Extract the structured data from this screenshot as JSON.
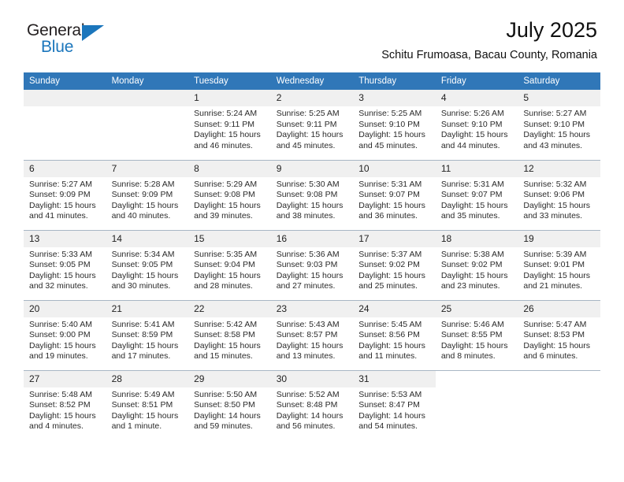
{
  "logo": {
    "word_one": "General",
    "word_two": "Blue",
    "triangle_color": "#1b76bc"
  },
  "header": {
    "title": "July 2025",
    "subtitle": "Schitu Frumoasa, Bacau County, Romania"
  },
  "theme": {
    "header_blue": "#3077b8",
    "day_band_gray": "#f0f0f0",
    "row_divider": "#a8b6c4"
  },
  "weekday_headers": [
    "Sunday",
    "Monday",
    "Tuesday",
    "Wednesday",
    "Thursday",
    "Friday",
    "Saturday"
  ],
  "labels": {
    "sunrise": "Sunrise:",
    "sunset": "Sunset:",
    "daylight": "Daylight:"
  },
  "weeks": [
    [
      {
        "day": "",
        "sunrise": "",
        "sunset": "",
        "daylight_line1": "",
        "daylight_line2": "",
        "banded": true
      },
      {
        "day": "",
        "sunrise": "",
        "sunset": "",
        "daylight_line1": "",
        "daylight_line2": "",
        "banded": true
      },
      {
        "day": "1",
        "sunrise": "Sunrise: 5:24 AM",
        "sunset": "Sunset: 9:11 PM",
        "daylight_line1": "Daylight: 15 hours",
        "daylight_line2": "and 46 minutes.",
        "banded": true
      },
      {
        "day": "2",
        "sunrise": "Sunrise: 5:25 AM",
        "sunset": "Sunset: 9:11 PM",
        "daylight_line1": "Daylight: 15 hours",
        "daylight_line2": "and 45 minutes.",
        "banded": true
      },
      {
        "day": "3",
        "sunrise": "Sunrise: 5:25 AM",
        "sunset": "Sunset: 9:10 PM",
        "daylight_line1": "Daylight: 15 hours",
        "daylight_line2": "and 45 minutes.",
        "banded": true
      },
      {
        "day": "4",
        "sunrise": "Sunrise: 5:26 AM",
        "sunset": "Sunset: 9:10 PM",
        "daylight_line1": "Daylight: 15 hours",
        "daylight_line2": "and 44 minutes.",
        "banded": true
      },
      {
        "day": "5",
        "sunrise": "Sunrise: 5:27 AM",
        "sunset": "Sunset: 9:10 PM",
        "daylight_line1": "Daylight: 15 hours",
        "daylight_line2": "and 43 minutes.",
        "banded": true
      }
    ],
    [
      {
        "day": "6",
        "sunrise": "Sunrise: 5:27 AM",
        "sunset": "Sunset: 9:09 PM",
        "daylight_line1": "Daylight: 15 hours",
        "daylight_line2": "and 41 minutes.",
        "banded": true
      },
      {
        "day": "7",
        "sunrise": "Sunrise: 5:28 AM",
        "sunset": "Sunset: 9:09 PM",
        "daylight_line1": "Daylight: 15 hours",
        "daylight_line2": "and 40 minutes.",
        "banded": true
      },
      {
        "day": "8",
        "sunrise": "Sunrise: 5:29 AM",
        "sunset": "Sunset: 9:08 PM",
        "daylight_line1": "Daylight: 15 hours",
        "daylight_line2": "and 39 minutes.",
        "banded": true
      },
      {
        "day": "9",
        "sunrise": "Sunrise: 5:30 AM",
        "sunset": "Sunset: 9:08 PM",
        "daylight_line1": "Daylight: 15 hours",
        "daylight_line2": "and 38 minutes.",
        "banded": true
      },
      {
        "day": "10",
        "sunrise": "Sunrise: 5:31 AM",
        "sunset": "Sunset: 9:07 PM",
        "daylight_line1": "Daylight: 15 hours",
        "daylight_line2": "and 36 minutes.",
        "banded": true
      },
      {
        "day": "11",
        "sunrise": "Sunrise: 5:31 AM",
        "sunset": "Sunset: 9:07 PM",
        "daylight_line1": "Daylight: 15 hours",
        "daylight_line2": "and 35 minutes.",
        "banded": true
      },
      {
        "day": "12",
        "sunrise": "Sunrise: 5:32 AM",
        "sunset": "Sunset: 9:06 PM",
        "daylight_line1": "Daylight: 15 hours",
        "daylight_line2": "and 33 minutes.",
        "banded": true
      }
    ],
    [
      {
        "day": "13",
        "sunrise": "Sunrise: 5:33 AM",
        "sunset": "Sunset: 9:05 PM",
        "daylight_line1": "Daylight: 15 hours",
        "daylight_line2": "and 32 minutes.",
        "banded": true
      },
      {
        "day": "14",
        "sunrise": "Sunrise: 5:34 AM",
        "sunset": "Sunset: 9:05 PM",
        "daylight_line1": "Daylight: 15 hours",
        "daylight_line2": "and 30 minutes.",
        "banded": true
      },
      {
        "day": "15",
        "sunrise": "Sunrise: 5:35 AM",
        "sunset": "Sunset: 9:04 PM",
        "daylight_line1": "Daylight: 15 hours",
        "daylight_line2": "and 28 minutes.",
        "banded": true
      },
      {
        "day": "16",
        "sunrise": "Sunrise: 5:36 AM",
        "sunset": "Sunset: 9:03 PM",
        "daylight_line1": "Daylight: 15 hours",
        "daylight_line2": "and 27 minutes.",
        "banded": true
      },
      {
        "day": "17",
        "sunrise": "Sunrise: 5:37 AM",
        "sunset": "Sunset: 9:02 PM",
        "daylight_line1": "Daylight: 15 hours",
        "daylight_line2": "and 25 minutes.",
        "banded": true
      },
      {
        "day": "18",
        "sunrise": "Sunrise: 5:38 AM",
        "sunset": "Sunset: 9:02 PM",
        "daylight_line1": "Daylight: 15 hours",
        "daylight_line2": "and 23 minutes.",
        "banded": true
      },
      {
        "day": "19",
        "sunrise": "Sunrise: 5:39 AM",
        "sunset": "Sunset: 9:01 PM",
        "daylight_line1": "Daylight: 15 hours",
        "daylight_line2": "and 21 minutes.",
        "banded": true
      }
    ],
    [
      {
        "day": "20",
        "sunrise": "Sunrise: 5:40 AM",
        "sunset": "Sunset: 9:00 PM",
        "daylight_line1": "Daylight: 15 hours",
        "daylight_line2": "and 19 minutes.",
        "banded": true
      },
      {
        "day": "21",
        "sunrise": "Sunrise: 5:41 AM",
        "sunset": "Sunset: 8:59 PM",
        "daylight_line1": "Daylight: 15 hours",
        "daylight_line2": "and 17 minutes.",
        "banded": true
      },
      {
        "day": "22",
        "sunrise": "Sunrise: 5:42 AM",
        "sunset": "Sunset: 8:58 PM",
        "daylight_line1": "Daylight: 15 hours",
        "daylight_line2": "and 15 minutes.",
        "banded": true
      },
      {
        "day": "23",
        "sunrise": "Sunrise: 5:43 AM",
        "sunset": "Sunset: 8:57 PM",
        "daylight_line1": "Daylight: 15 hours",
        "daylight_line2": "and 13 minutes.",
        "banded": true
      },
      {
        "day": "24",
        "sunrise": "Sunrise: 5:45 AM",
        "sunset": "Sunset: 8:56 PM",
        "daylight_line1": "Daylight: 15 hours",
        "daylight_line2": "and 11 minutes.",
        "banded": true
      },
      {
        "day": "25",
        "sunrise": "Sunrise: 5:46 AM",
        "sunset": "Sunset: 8:55 PM",
        "daylight_line1": "Daylight: 15 hours",
        "daylight_line2": "and 8 minutes.",
        "banded": true
      },
      {
        "day": "26",
        "sunrise": "Sunrise: 5:47 AM",
        "sunset": "Sunset: 8:53 PM",
        "daylight_line1": "Daylight: 15 hours",
        "daylight_line2": "and 6 minutes.",
        "banded": true
      }
    ],
    [
      {
        "day": "27",
        "sunrise": "Sunrise: 5:48 AM",
        "sunset": "Sunset: 8:52 PM",
        "daylight_line1": "Daylight: 15 hours",
        "daylight_line2": "and 4 minutes.",
        "banded": true
      },
      {
        "day": "28",
        "sunrise": "Sunrise: 5:49 AM",
        "sunset": "Sunset: 8:51 PM",
        "daylight_line1": "Daylight: 15 hours",
        "daylight_line2": "and 1 minute.",
        "banded": true
      },
      {
        "day": "29",
        "sunrise": "Sunrise: 5:50 AM",
        "sunset": "Sunset: 8:50 PM",
        "daylight_line1": "Daylight: 14 hours",
        "daylight_line2": "and 59 minutes.",
        "banded": true
      },
      {
        "day": "30",
        "sunrise": "Sunrise: 5:52 AM",
        "sunset": "Sunset: 8:48 PM",
        "daylight_line1": "Daylight: 14 hours",
        "daylight_line2": "and 56 minutes.",
        "banded": true
      },
      {
        "day": "31",
        "sunrise": "Sunrise: 5:53 AM",
        "sunset": "Sunset: 8:47 PM",
        "daylight_line1": "Daylight: 14 hours",
        "daylight_line2": "and 54 minutes.",
        "banded": true
      },
      {
        "day": "",
        "sunrise": "",
        "sunset": "",
        "daylight_line1": "",
        "daylight_line2": "",
        "banded": false
      },
      {
        "day": "",
        "sunrise": "",
        "sunset": "",
        "daylight_line1": "",
        "daylight_line2": "",
        "banded": false
      }
    ]
  ]
}
